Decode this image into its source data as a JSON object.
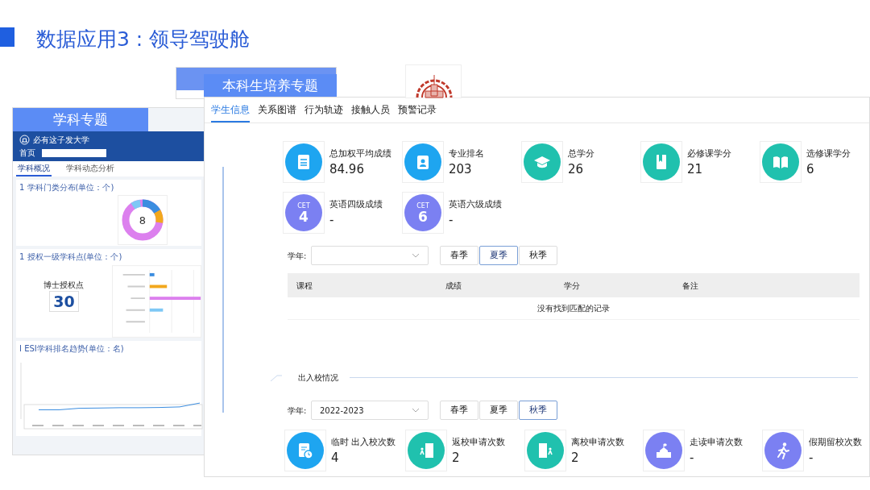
{
  "slide_title": "数据应用3 : 领导驾驶舱",
  "banner": "本科生培养专题",
  "left_screen": {
    "banner": "学科专题",
    "site_name": "必有这子发大学",
    "nav_home": "首页",
    "subtabs": [
      {
        "label": "学科概况",
        "selected": true
      },
      {
        "label": "学科动态分析",
        "selected": false
      }
    ],
    "section_1": {
      "title": "1  学科门类分布(单位：个)",
      "donut_center": "8"
    },
    "section_2": {
      "title": "1  授权一级学科点(单位：个)",
      "stat_label": "博士授权点",
      "stat_value": "30"
    },
    "section_3": {
      "title": "I  ESI学科排名趋势(单位：名)"
    }
  },
  "tabs": [
    {
      "label": "学生信息",
      "selected": true
    },
    {
      "label": "关系图谱",
      "selected": false
    },
    {
      "label": "行为轨迹",
      "selected": false
    },
    {
      "label": "接触人员",
      "selected": false
    },
    {
      "label": "预警记录",
      "selected": false
    }
  ],
  "grade_cards": [
    {
      "kind": "document",
      "color": "#1ea5f0",
      "label": "总加权平均成绩",
      "value": "84.96"
    },
    {
      "kind": "badge",
      "color": "#1ea5f0",
      "label": "专业排名",
      "value": "203"
    },
    {
      "kind": "cap",
      "color": "#20c1ae",
      "label": "总学分",
      "value": "26"
    },
    {
      "kind": "book",
      "color": "#20c1ae",
      "label": "必修课学分",
      "value": "21"
    },
    {
      "kind": "open-book",
      "color": "#20c1ae",
      "label": "选修课学分",
      "value": "6"
    },
    {
      "kind": "cet",
      "color": "#7b80f2",
      "icon_label": "CET",
      "icon_number": "4",
      "label": "英语四级成绩",
      "value": "-"
    },
    {
      "kind": "cet",
      "color": "#7b80f2",
      "icon_label": "CET",
      "icon_number": "6",
      "label": "英语六级成绩",
      "value": "-"
    }
  ],
  "grade_filter": {
    "year_label": "学年:",
    "seasons": [
      {
        "label": "春季",
        "selected": false
      },
      {
        "label": "夏季",
        "selected": true
      },
      {
        "label": "秋季",
        "selected": false
      }
    ]
  },
  "table": {
    "columns": [
      "课程",
      "成绩",
      "学分",
      "备注"
    ],
    "empty_message": "没有找到匹配的记录"
  },
  "campus_section": {
    "title": "出入校情况",
    "year_label": "学年:",
    "year": "2022-2023",
    "seasons": [
      {
        "label": "春季",
        "selected": false
      },
      {
        "label": "夏季",
        "selected": false
      },
      {
        "label": "秋季",
        "selected": true
      }
    ],
    "cards": [
      {
        "kind": "clock-doc",
        "color": "#1ea5f0",
        "label": "临时 出入校次数",
        "value": "4"
      },
      {
        "kind": "door-in",
        "color": "#20c1ae",
        "label": "返校申请次数",
        "value": "2"
      },
      {
        "kind": "door-out",
        "color": "#20c1ae",
        "label": "离校申请次数",
        "value": "2"
      },
      {
        "kind": "school",
        "color": "#7b80f2",
        "label": "走读申请次数",
        "value": "-"
      },
      {
        "kind": "runner",
        "color": "#7b80f2",
        "label": "假期留校次数",
        "value": "-"
      }
    ]
  }
}
